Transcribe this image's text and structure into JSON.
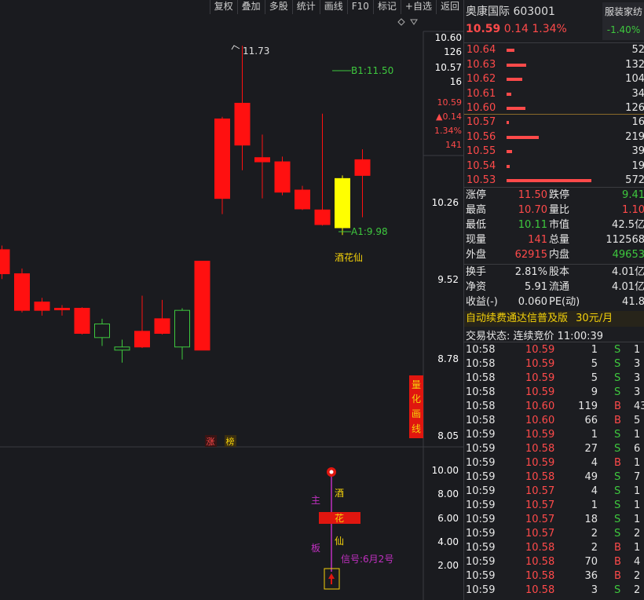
{
  "toolbar": {
    "buttons": [
      "复权",
      "叠加",
      "多股",
      "统计",
      "画线",
      "F10",
      "标记",
      "+自选",
      "返回"
    ]
  },
  "stock": {
    "name": "奥康国际",
    "code": "603001",
    "price": "10.59",
    "change": "0.14",
    "pct": "1.34%",
    "sector": "服装家纺",
    "sector_pct": "-1.40%"
  },
  "asks": [
    {
      "p": "10.64",
      "v": "52",
      "bar": 52
    },
    {
      "p": "10.63",
      "v": "132",
      "bar": 132
    },
    {
      "p": "10.62",
      "v": "104",
      "bar": 104
    },
    {
      "p": "10.61",
      "v": "34",
      "bar": 34
    },
    {
      "p": "10.60",
      "v": "126",
      "bar": 126
    }
  ],
  "bids": [
    {
      "p": "10.57",
      "v": "16",
      "bar": 16
    },
    {
      "p": "10.56",
      "v": "219",
      "bar": 219
    },
    {
      "p": "10.55",
      "v": "39",
      "bar": 39
    },
    {
      "p": "10.54",
      "v": "19",
      "bar": 19
    },
    {
      "p": "10.53",
      "v": "572",
      "bar": 572
    }
  ],
  "stats": [
    {
      "l1": "涨停",
      "v1": "11.50",
      "c1": "red",
      "l2": "跌停",
      "v2": "9.41",
      "c2": "green"
    },
    {
      "l1": "最高",
      "v1": "10.70",
      "c1": "red",
      "l2": "量比",
      "v2": "1.10",
      "c2": "red"
    },
    {
      "l1": "最低",
      "v1": "10.11",
      "c1": "green",
      "l2": "市值",
      "v2": "42.5亿",
      "c2": "white"
    },
    {
      "l1": "现量",
      "v1": "141",
      "c1": "red",
      "l2": "总量",
      "v2": "112568",
      "c2": "white"
    },
    {
      "l1": "外盘",
      "v1": "62915",
      "c1": "red",
      "l2": "内盘",
      "v2": "49653",
      "c2": "green"
    },
    {
      "l1": "换手",
      "v1": "2.81%",
      "c1": "white",
      "l2": "股本",
      "v2": "4.01亿",
      "c2": "white"
    },
    {
      "l1": "净资",
      "v1": "5.91",
      "c1": "white",
      "l2": "流通",
      "v2": "4.01亿",
      "c2": "white"
    },
    {
      "l1": "收益(-)",
      "v1": "0.060",
      "c1": "white",
      "l2": "PE(动)",
      "v2": "41.8",
      "c2": "white"
    }
  ],
  "promo": {
    "text": "自动续费通达信普及版",
    "price": "30元/月"
  },
  "trade_status": "交易状态: 连续竞价 11:00:39",
  "ticks": [
    [
      "10:58",
      "10.59",
      "1",
      "S",
      "1"
    ],
    [
      "10:58",
      "10.59",
      "5",
      "S",
      "3"
    ],
    [
      "10:58",
      "10.59",
      "5",
      "S",
      "3"
    ],
    [
      "10:58",
      "10.59",
      "9",
      "S",
      "3"
    ],
    [
      "10:58",
      "10.60",
      "119",
      "B",
      "43"
    ],
    [
      "10:58",
      "10.60",
      "66",
      "B",
      "5"
    ],
    [
      "10:59",
      "10.59",
      "1",
      "S",
      "1"
    ],
    [
      "10:59",
      "10.58",
      "27",
      "S",
      "6"
    ],
    [
      "10:59",
      "10.59",
      "4",
      "B",
      "1"
    ],
    [
      "10:59",
      "10.58",
      "49",
      "S",
      "7"
    ],
    [
      "10:59",
      "10.57",
      "4",
      "S",
      "1"
    ],
    [
      "10:59",
      "10.57",
      "1",
      "S",
      "1"
    ],
    [
      "10:59",
      "10.57",
      "18",
      "S",
      "1"
    ],
    [
      "10:59",
      "10.57",
      "2",
      "S",
      "2"
    ],
    [
      "10:59",
      "10.58",
      "2",
      "B",
      "1"
    ],
    [
      "10:59",
      "10.58",
      "70",
      "B",
      "4"
    ],
    [
      "10:59",
      "10.58",
      "36",
      "B",
      "2"
    ],
    [
      "10:59",
      "10.58",
      "3",
      "S",
      "2"
    ]
  ],
  "price_axis": {
    "top": "10.60",
    "top_vol": "126",
    "p2": "10.57",
    "p2_vol": "16",
    "cur": "10.59",
    "cur_chg": "▲0.14",
    "cur_pct": "1.34%",
    "cur_vol": "141",
    "l1": "10.26",
    "l2": "9.52",
    "l3": "8.78",
    "l4": "8.05"
  },
  "chart_data": {
    "type": "candlestick",
    "candles": [
      {
        "o": 9.78,
        "c": 9.55,
        "h": 9.82,
        "l": 9.5,
        "color": "red"
      },
      {
        "o": 9.55,
        "c": 9.2,
        "h": 9.6,
        "l": 9.18,
        "color": "red"
      },
      {
        "o": 9.2,
        "c": 9.28,
        "h": 9.32,
        "l": 9.15,
        "color": "red"
      },
      {
        "o": 9.22,
        "c": 9.22,
        "h": 9.25,
        "l": 9.15,
        "color": "red"
      },
      {
        "o": 9.22,
        "c": 8.98,
        "h": 9.23,
        "l": 8.97,
        "color": "red"
      },
      {
        "o": 8.94,
        "c": 9.07,
        "h": 9.12,
        "l": 8.86,
        "color": "green"
      },
      {
        "o": 8.85,
        "c": 8.82,
        "h": 8.92,
        "l": 8.7,
        "color": "green"
      },
      {
        "o": 8.85,
        "c": 9.0,
        "h": 9.34,
        "l": 8.84,
        "color": "red"
      },
      {
        "o": 8.98,
        "c": 9.12,
        "h": 9.3,
        "l": 8.97,
        "color": "red"
      },
      {
        "o": 8.85,
        "c": 9.2,
        "h": 9.22,
        "l": 8.73,
        "color": "green"
      },
      {
        "o": 8.82,
        "c": 9.67,
        "h": 9.67,
        "l": 8.82,
        "color": "red"
      },
      {
        "o": 10.27,
        "c": 11.03,
        "h": 11.05,
        "l": 10.12,
        "color": "red"
      },
      {
        "o": 10.78,
        "c": 11.18,
        "h": 11.73,
        "l": 10.54,
        "color": "red"
      },
      {
        "o": 10.62,
        "c": 10.66,
        "h": 10.88,
        "l": 10.27,
        "color": "red"
      },
      {
        "o": 10.33,
        "c": 10.62,
        "h": 10.67,
        "l": 10.3,
        "color": "red"
      },
      {
        "o": 10.17,
        "c": 10.35,
        "h": 10.39,
        "l": 10.16,
        "color": "red"
      },
      {
        "o": 10.16,
        "c": 10.02,
        "h": 11.08,
        "l": 10.01,
        "color": "red"
      },
      {
        "o": 10.46,
        "c": 9.99,
        "h": 10.49,
        "l": 9.92,
        "color": "yellow"
      },
      {
        "o": 10.49,
        "c": 10.64,
        "h": 10.74,
        "l": 10.09,
        "color": "red"
      }
    ],
    "price_labels": {
      "high": "11.73",
      "b1": "B1:11.50",
      "a1": "A1:9.98",
      "name_label": "酒花仙"
    },
    "sub_axis": [
      "10.00",
      "8.00",
      "6.00",
      "4.00",
      "2.00"
    ],
    "side_tag": [
      "量",
      "化",
      "画",
      "线"
    ],
    "tags": [
      "涨",
      "榜"
    ],
    "sub_labels": {
      "zhu": "主",
      "ban": "板",
      "c1": "酒",
      "c2": "花",
      "c3": "仙",
      "signal": "信号:6月2号"
    }
  }
}
